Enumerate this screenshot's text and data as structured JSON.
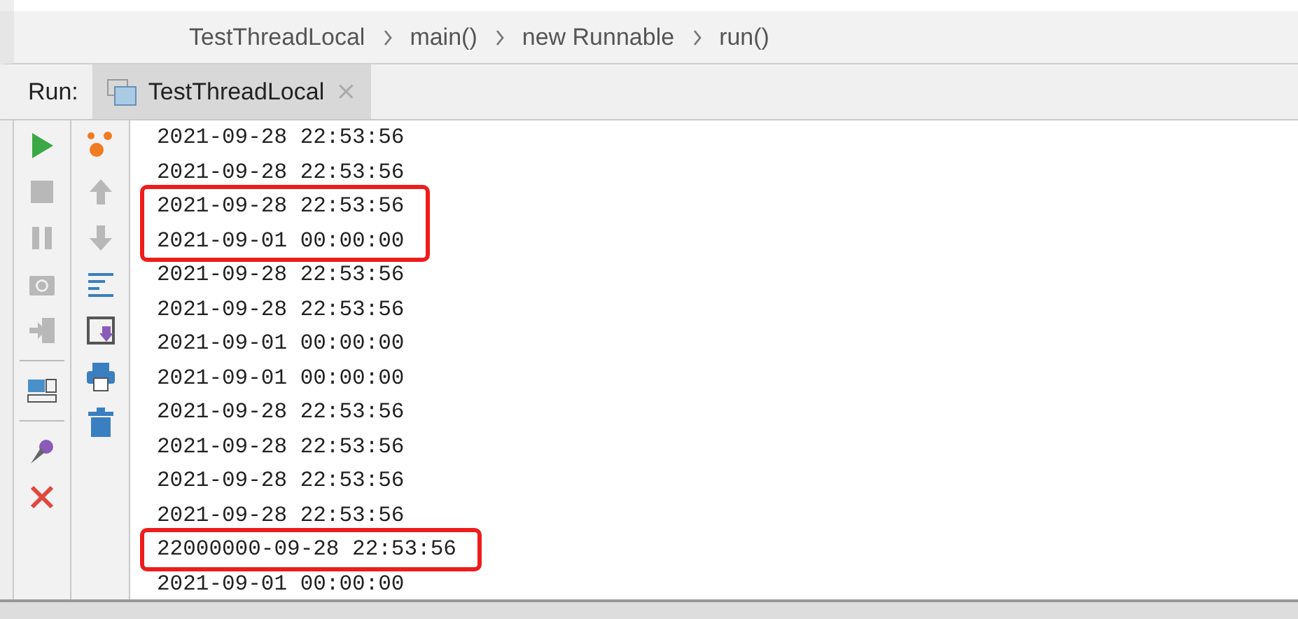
{
  "breadcrumb": [
    "TestThreadLocal",
    "main()",
    "new Runnable",
    "run()"
  ],
  "run_panel": {
    "label": "Run:",
    "tabs": [
      {
        "label": "TestThreadLocal",
        "selected": true,
        "close": "×"
      }
    ]
  },
  "toolbar_left": [
    {
      "kind": "run",
      "disabled": false
    },
    {
      "kind": "stop",
      "disabled": true
    },
    {
      "kind": "pause",
      "disabled": true
    },
    {
      "kind": "camera",
      "disabled": true
    },
    {
      "kind": "exit",
      "disabled": true
    },
    {
      "kind": "separator"
    },
    {
      "kind": "layout",
      "disabled": false
    },
    {
      "kind": "separator"
    },
    {
      "kind": "pin",
      "disabled": false
    },
    {
      "kind": "close",
      "disabled": false
    }
  ],
  "toolbar_right": [
    {
      "kind": "dots",
      "disabled": false
    },
    {
      "kind": "up",
      "disabled": true
    },
    {
      "kind": "down",
      "disabled": true
    },
    {
      "kind": "wrap",
      "disabled": false
    },
    {
      "kind": "scroll-end",
      "disabled": false
    },
    {
      "kind": "print",
      "disabled": false
    },
    {
      "kind": "trash",
      "disabled": false
    }
  ],
  "console": [
    {
      "highlighted": false,
      "lines": [
        "2021-09-28 22:53:56",
        "2021-09-28 22:53:56"
      ]
    },
    {
      "highlighted": true,
      "lines": [
        "2021-09-28 22:53:56",
        "2021-09-01 00:00:00"
      ]
    },
    {
      "highlighted": false,
      "lines": [
        "2021-09-28 22:53:56",
        "2021-09-28 22:53:56",
        "2021-09-01 00:00:00",
        "2021-09-01 00:00:00",
        "2021-09-28 22:53:56",
        "2021-09-28 22:53:56",
        "2021-09-28 22:53:56",
        "2021-09-28 22:53:56"
      ]
    },
    {
      "highlighted": true,
      "lines": [
        "22000000-09-28 22:53:56"
      ]
    },
    {
      "highlighted": false,
      "lines": [
        "2021-09-01 00:00:00"
      ]
    }
  ]
}
